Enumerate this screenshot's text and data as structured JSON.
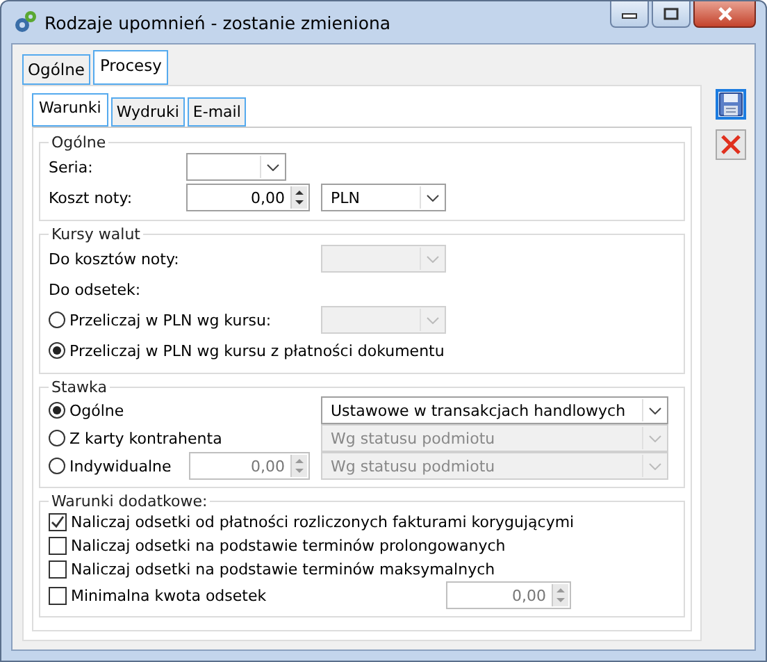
{
  "window": {
    "title": "Rodzaje upomnień - zostanie zmieniona"
  },
  "tabs": [
    {
      "label": "Ogólne",
      "selected": false
    },
    {
      "label": "Procesy",
      "selected": true
    }
  ],
  "subtabs": [
    {
      "label": "Warunki",
      "selected": true
    },
    {
      "label": "Wydruki",
      "selected": false
    },
    {
      "label": "E-mail",
      "selected": false
    }
  ],
  "general": {
    "title": "Ogólne",
    "series_label": "Seria:",
    "series_combo": {
      "disabled": false
    },
    "cost_label": "Koszt noty:",
    "cost_value": "0,00",
    "currency_combo": {
      "value": "PLN",
      "disabled": false
    }
  },
  "rates": {
    "title": "Kursy walut",
    "cost_label": "Do kosztów noty:",
    "cost_combo": {
      "disabled": true
    },
    "interest_label": "Do odsetek:",
    "options": [
      {
        "label": "Przeliczaj w PLN wg kursu:",
        "selected": false,
        "combo": {
          "disabled": true
        }
      },
      {
        "label": "Przeliczaj w PLN wg kursu z płatności dokumentu",
        "selected": true
      }
    ]
  },
  "rate": {
    "title": "Stawka",
    "options": [
      {
        "label": "Ogólne",
        "selected": true,
        "combo": {
          "value": "Ustawowe w transakcjach handlowych",
          "disabled": false
        }
      },
      {
        "label": "Z karty kontrahenta",
        "selected": false,
        "combo": {
          "value": "Wg statusu podmiotu",
          "disabled": true
        }
      },
      {
        "label": "Indywidualne",
        "selected": false,
        "spinner": {
          "value": "0,00",
          "disabled": true
        },
        "combo": {
          "value": "Wg statusu podmiotu",
          "disabled": true
        }
      }
    ]
  },
  "extra": {
    "title": "Warunki dodatkowe:",
    "items": [
      {
        "label": "Naliczaj odsetki od płatności rozliczonych fakturami korygującymi",
        "checked": true
      },
      {
        "label": "Naliczaj odsetki na podstawie terminów prolongowanych",
        "checked": false
      },
      {
        "label": "Naliczaj odsetki na podstawie terminów maksymalnych",
        "checked": false
      },
      {
        "label": "Minimalna kwota odsetek",
        "checked": false,
        "spinner": {
          "value": "0,00",
          "disabled": true
        }
      }
    ]
  }
}
